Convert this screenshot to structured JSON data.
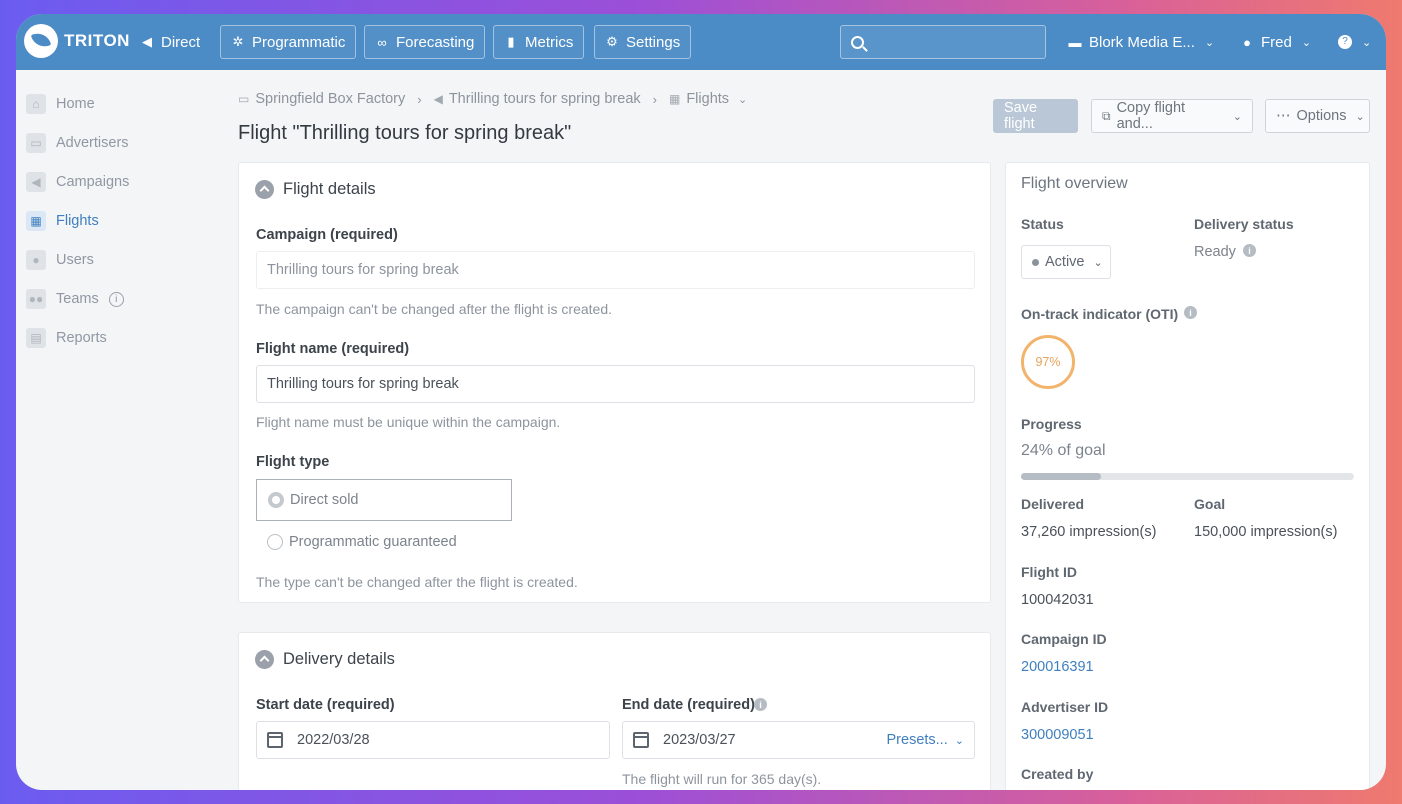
{
  "nav": {
    "logo_text": "TRITON",
    "direct": "Direct",
    "programmatic": "Programmatic",
    "forecasting": "Forecasting",
    "metrics": "Metrics",
    "settings": "Settings",
    "org": "Blork Media E...",
    "user": "Fred"
  },
  "sidebar": {
    "items": [
      {
        "label": "Home"
      },
      {
        "label": "Advertisers"
      },
      {
        "label": "Campaigns"
      },
      {
        "label": "Flights"
      },
      {
        "label": "Users"
      },
      {
        "label": "Teams"
      },
      {
        "label": "Reports"
      }
    ]
  },
  "breadcrumb": {
    "advertiser": "Springfield Box Factory",
    "campaign": "Thrilling tours for spring break",
    "section": "Flights"
  },
  "page": {
    "title": "Flight \"Thrilling tours for spring break\""
  },
  "actions": {
    "save": "Save flight",
    "copy": "Copy flight and...",
    "options": "Options"
  },
  "flight_details": {
    "heading": "Flight details",
    "campaign_label": "Campaign (required)",
    "campaign_value": "Thrilling tours for spring break",
    "campaign_help": "The campaign can't be changed after the flight is created.",
    "name_label": "Flight name (required)",
    "name_value": "Thrilling tours for spring break",
    "name_help": "Flight name must be unique within the campaign.",
    "type_label": "Flight type",
    "type_options": [
      "Direct sold",
      "Programmatic guaranteed"
    ],
    "type_selected": "Direct sold",
    "type_help": "The type can't be changed after the flight is created."
  },
  "delivery_details": {
    "heading": "Delivery details",
    "start_label": "Start date (required)",
    "start_value": "2022/03/28",
    "end_label": "End date (required)",
    "end_value": "2023/03/27",
    "presets": "Presets...",
    "duration_help": "The flight will run for 365 day(s)."
  },
  "overview": {
    "heading": "Flight overview",
    "status_label": "Status",
    "status_value": "Active",
    "delivery_status_label": "Delivery status",
    "delivery_status_value": "Ready",
    "oti_label": "On-track indicator (OTI)",
    "oti_value": "97%",
    "progress_label": "Progress",
    "progress_value": "24% of goal",
    "progress_fraction": 0.24,
    "delivered_label": "Delivered",
    "delivered_value": "37,260 impression(s)",
    "goal_label": "Goal",
    "goal_value": "150,000 impression(s)",
    "flight_id_label": "Flight ID",
    "flight_id_value": "100042031",
    "campaign_id_label": "Campaign ID",
    "campaign_id_value": "200016391",
    "advertiser_id_label": "Advertiser ID",
    "advertiser_id_value": "300009051",
    "created_by_label": "Created by"
  }
}
